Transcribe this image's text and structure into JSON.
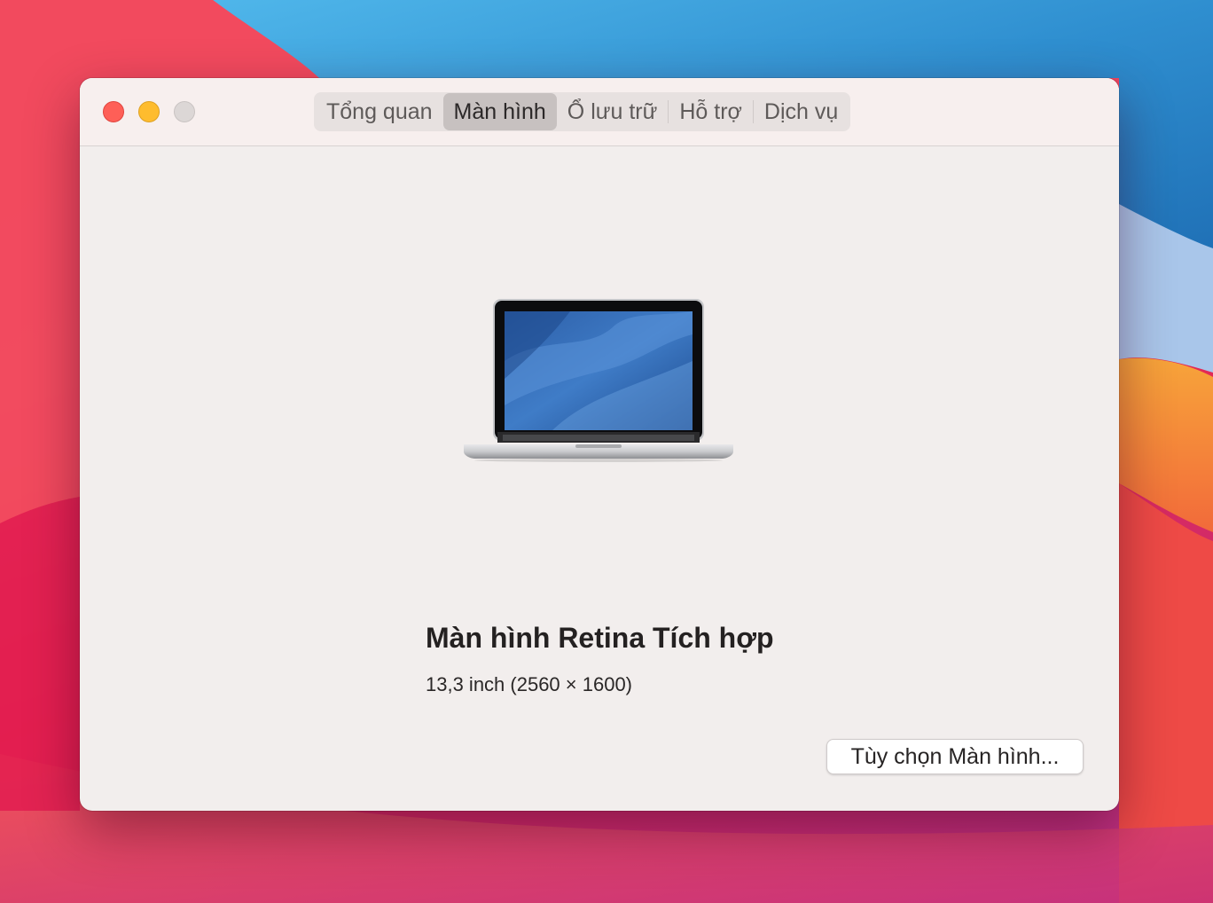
{
  "window": {
    "tabs": [
      {
        "label": "Tổng quan",
        "active": false
      },
      {
        "label": "Màn hình",
        "active": true
      },
      {
        "label": "Ổ lưu trữ",
        "active": false
      },
      {
        "label": "Hỗ trợ",
        "active": false
      },
      {
        "label": "Dịch vụ",
        "active": false
      }
    ]
  },
  "display": {
    "name": "Màn hình Retina Tích hợp",
    "spec": "13,3 inch (2560 × 1600)",
    "image_icon": "macbook-pro-laptop-icon"
  },
  "buttons": {
    "display_options": "Tùy chọn Màn hình..."
  },
  "colors": {
    "close": "#fe5f57",
    "minimize": "#febc2e",
    "zoom": "#dcd7d6",
    "active_tab": "#c7c1c0"
  }
}
